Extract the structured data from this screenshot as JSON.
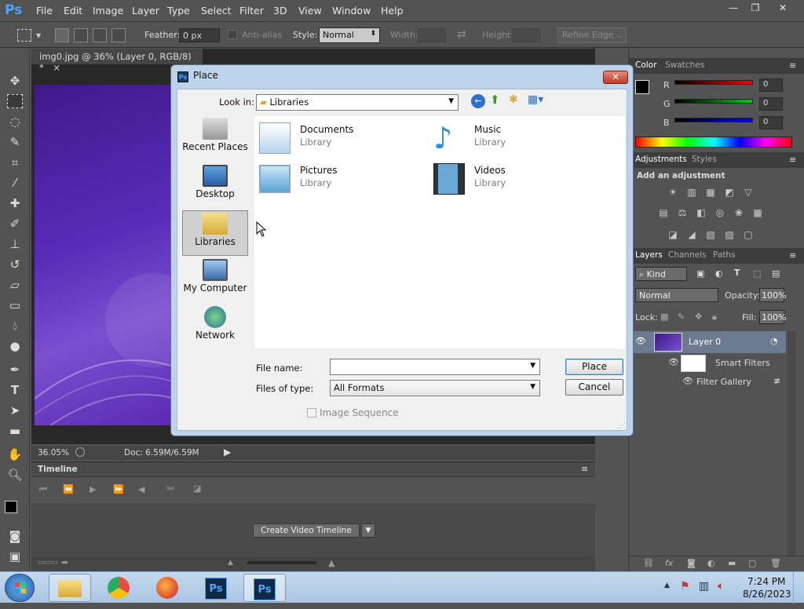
{
  "app": {
    "logo": "Ps"
  },
  "menu": [
    "File",
    "Edit",
    "Image",
    "Layer",
    "Type",
    "Select",
    "Filter",
    "3D",
    "View",
    "Window",
    "Help"
  ],
  "window_controls": {
    "minimize": "—",
    "restore": "❐",
    "close": "✕"
  },
  "options": {
    "feather_label": "Feather:",
    "feather_value": "0 px",
    "antialias_label": "Anti-alias",
    "style_label": "Style:",
    "style_value": "Normal",
    "width_label": "Width:",
    "height_label": "Height:",
    "refine_edge": "Refine Edge..."
  },
  "document": {
    "tab_title": "img0.jpg @ 36% (Layer 0, RGB/8) *",
    "tab_close": "×",
    "zoom": "36.05%",
    "doc_size": "Doc: 6.59M/6.59M"
  },
  "timeline": {
    "title": "Timeline",
    "create_button": "Create Video Timeline"
  },
  "color_panel": {
    "tab_color": "Color",
    "tab_swatches": "Swatches",
    "r_label": "R",
    "g_label": "G",
    "b_label": "B",
    "r_value": "0",
    "g_value": "0",
    "b_value": "0"
  },
  "adjustments_panel": {
    "tab_adjustments": "Adjustments",
    "tab_styles": "Styles",
    "heading": "Add an adjustment"
  },
  "layers_panel": {
    "tab_layers": "Layers",
    "tab_channels": "Channels",
    "tab_paths": "Paths",
    "filter_kind": "Kind",
    "blend_mode": "Normal",
    "opacity_label": "Opacity:",
    "opacity_value": "100%",
    "lock_label": "Lock:",
    "fill_label": "Fill:",
    "fill_value": "100%",
    "layer_name": "Layer 0",
    "smart_filters": "Smart Filters",
    "filter_gallery": "Filter Gallery"
  },
  "dialog": {
    "title": "Place",
    "look_in_label": "Look in:",
    "look_in_value": "Libraries",
    "places": [
      {
        "label": "Recent Places",
        "selected": false
      },
      {
        "label": "Desktop",
        "selected": false
      },
      {
        "label": "Libraries",
        "selected": true
      },
      {
        "label": "My Computer",
        "selected": false
      },
      {
        "label": "Network",
        "selected": false
      }
    ],
    "files": [
      {
        "name": "Documents",
        "type": "Library"
      },
      {
        "name": "Music",
        "type": "Library"
      },
      {
        "name": "Pictures",
        "type": "Library"
      },
      {
        "name": "Videos",
        "type": "Library"
      }
    ],
    "file_name_label": "File name:",
    "file_name_value": "",
    "files_of_type_label": "Files of type:",
    "files_of_type_value": "All Formats",
    "image_sequence_label": "Image Sequence",
    "place_button": "Place",
    "cancel_button": "Cancel"
  },
  "taskbar": {
    "time": "7:24 PM",
    "date": "8/26/2023"
  },
  "colors": {
    "accent": "#4fa3ff",
    "dialog_frame": "#bcd3ea",
    "canvas_purple": "#5a2bb8"
  }
}
